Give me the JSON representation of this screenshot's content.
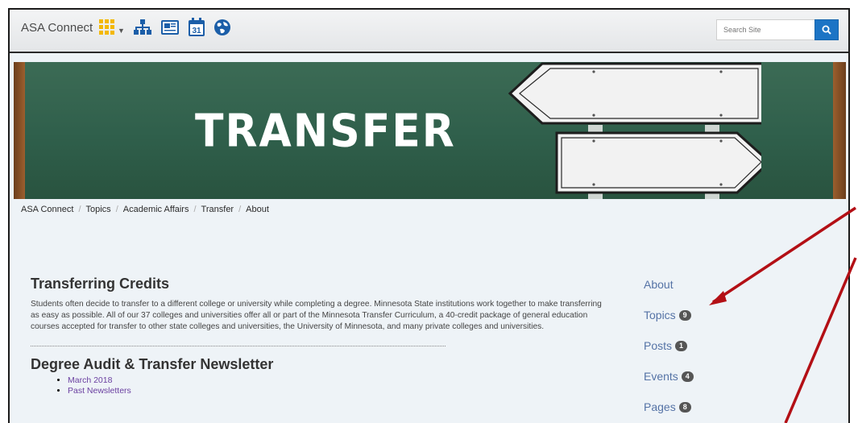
{
  "header": {
    "brand": "ASA Connect",
    "search": {
      "placeholder": "Search Site"
    }
  },
  "icons": [
    "apps-grid-icon",
    "org-chart-icon",
    "newspaper-icon",
    "calendar-icon",
    "globe-icon",
    "search-icon"
  ],
  "hero": {
    "title": "TRANSFER"
  },
  "breadcrumb": [
    "ASA Connect",
    "Topics",
    "Academic Affairs",
    "Transfer",
    "About"
  ],
  "main": {
    "title": "Transferring Credits",
    "paragraph": "Students often decide to transfer to a different college or university while completing a degree. Minnesota State institutions work together to make transferring as easy as possible. All of our 37 colleges and universities offer all or part of the Minnesota Transfer Curriculum, a 40-credit package of general education courses accepted for transfer to other state colleges and universities, the University of Minnesota, and many private colleges and universities.",
    "newsletter_title": "Degree Audit & Transfer Newsletter",
    "newsletter_links": [
      "March 2018",
      "Past Newsletters"
    ]
  },
  "sidenav": [
    {
      "label": "About",
      "count": ""
    },
    {
      "label": "Topics",
      "count": "9"
    },
    {
      "label": "Posts",
      "count": "1"
    },
    {
      "label": "Events",
      "count": "4"
    },
    {
      "label": "Pages",
      "count": "8"
    }
  ],
  "colors": {
    "accent": "#1c74c5",
    "nav_link": "#5573a6",
    "annotation": "#b30f15",
    "board": "#2f5f4b"
  }
}
